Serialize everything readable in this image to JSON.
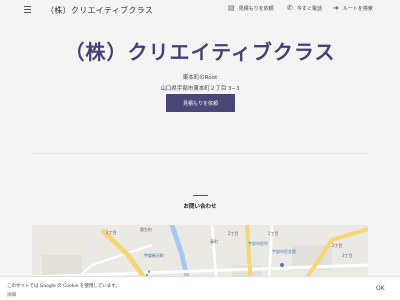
{
  "header": {
    "site_name": "（株）クリエイティブクラス",
    "nav": [
      {
        "label": "見積もりを依頼",
        "icon": "quote-icon"
      },
      {
        "label": "今すぐ電話",
        "icon": "phone-icon"
      },
      {
        "label": "ルートを検索",
        "icon": "route-icon"
      }
    ]
  },
  "hero": {
    "title": "（株）クリエイティブクラス",
    "subtitle": "東本町のRoot",
    "address": "山口県宇部市東本町２丁目 3−3",
    "cta_label": "見積もりを依頼"
  },
  "contact": {
    "heading": "お問い合わせ"
  },
  "map": {
    "labels": [
      "錦生町",
      "2丁目",
      "春町",
      "2丁目",
      "2丁目",
      "宇部市役所",
      "宇部新天町",
      "2丁目",
      "宇部市民会館",
      "3丁目"
    ]
  },
  "cookie": {
    "text": "このサイトでは Google の Cookie を使用しています。",
    "more_label": "詳細",
    "ok_label": "OK"
  },
  "colors": {
    "brand": "#454075",
    "button": "#4a4676",
    "map_road": "#f5d77a",
    "map_water": "#a9c8f0"
  }
}
